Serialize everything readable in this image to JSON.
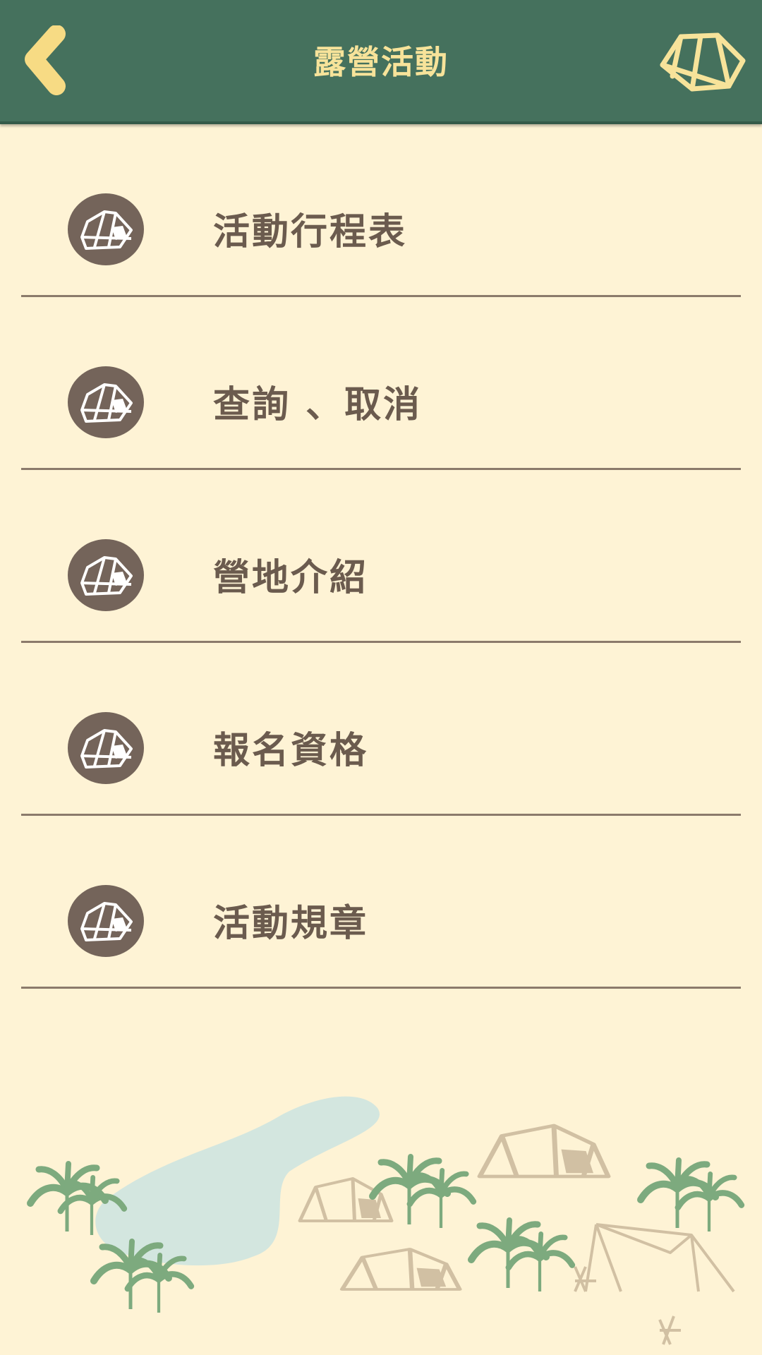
{
  "header": {
    "title": "露營活動",
    "back_icon": "chevron-left-icon",
    "right_icon": "tent-icon",
    "background": "#45715d",
    "accent": "#f7e39a"
  },
  "menu": {
    "items": [
      {
        "label": "活動行程表",
        "icon": "tent-icon"
      },
      {
        "label": "查詢 、取消",
        "icon": "tent-icon"
      },
      {
        "label": "營地介紹",
        "icon": "tent-icon"
      },
      {
        "label": "報名資格",
        "icon": "tent-icon"
      },
      {
        "label": "活動規章",
        "icon": "tent-icon"
      }
    ],
    "label_color": "#6b5b4e",
    "icon_bg": "#74645a"
  },
  "scenery": {
    "icons": [
      "pond-illustration",
      "palm-tree-icon",
      "tent-icon",
      "canopy-icon",
      "camp-chair-icon"
    ]
  }
}
